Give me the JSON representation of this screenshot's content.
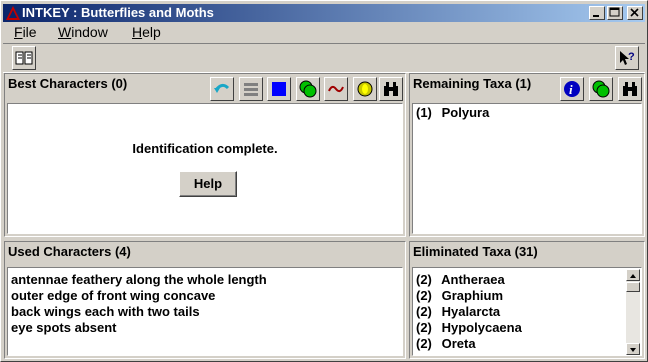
{
  "window": {
    "title": "INTKEY : Butterflies and Moths",
    "controls": [
      "minimize",
      "maximize",
      "close"
    ]
  },
  "menu": {
    "file": "File",
    "file_hotkey": "F",
    "window": "Window",
    "window_hotkey": "W",
    "help": "Help",
    "help_hotkey": "H"
  },
  "toolbar": {
    "icons": [
      "open-book-icon",
      "context-help-icon"
    ]
  },
  "best_characters": {
    "title": "Best Characters (0)",
    "tools": [
      "restart-icon",
      "diagnose-icon",
      "select-all-icon",
      "used-characters-icon",
      "separate-icon",
      "find-icon",
      "binoculars-icon"
    ],
    "message": "Identification complete.",
    "help_button": "Help"
  },
  "remaining_taxa": {
    "title": "Remaining Taxa (1)",
    "tools": [
      "info-icon",
      "differences-icon",
      "binoculars-icon"
    ],
    "items": [
      {
        "num": "(1)",
        "name": "Polyura"
      }
    ]
  },
  "used_characters": {
    "title": "Used Characters (4)",
    "items": [
      "antennae feathery along the whole length",
      "outer edge of front wing concave",
      "back wings each with two tails",
      "eye spots absent"
    ]
  },
  "eliminated_taxa": {
    "title": "Eliminated Taxa (31)",
    "items": [
      {
        "num": "(2)",
        "name": "Antheraea"
      },
      {
        "num": "(2)",
        "name": "Graphium"
      },
      {
        "num": "(2)",
        "name": "Hyalarcta"
      },
      {
        "num": "(2)",
        "name": "Hypolycaena"
      },
      {
        "num": "(2)",
        "name": "Oreta"
      }
    ]
  },
  "colors": {
    "title_start": "#0a246a",
    "title_end": "#a6caf0",
    "face": "#d4d0c8"
  }
}
